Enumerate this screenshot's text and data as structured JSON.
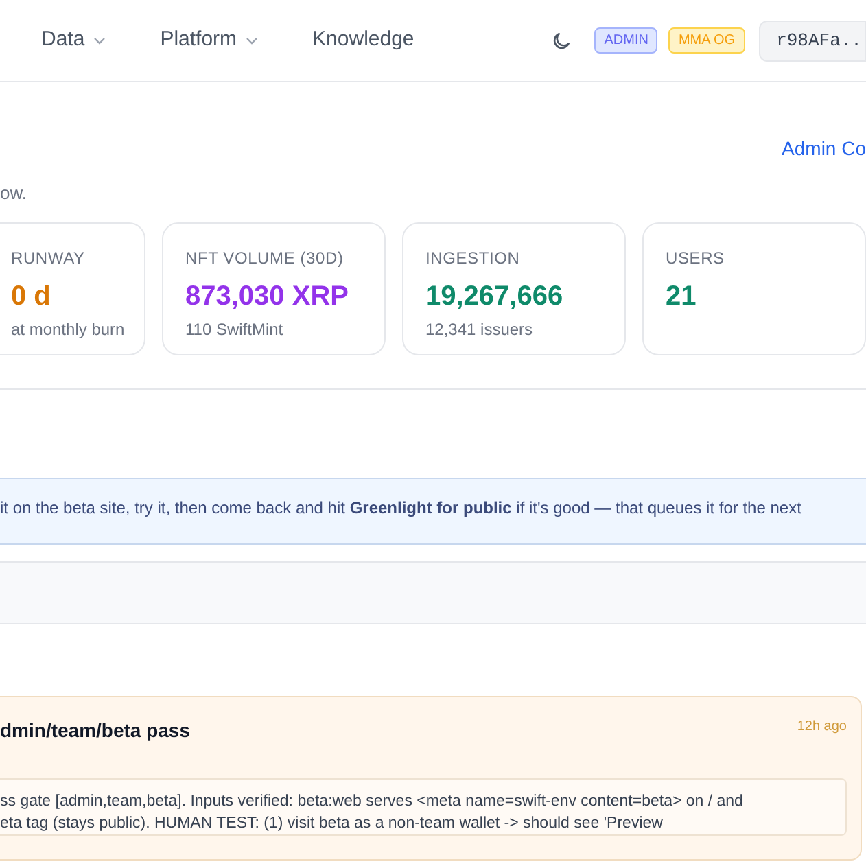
{
  "nav": {
    "items": [
      {
        "label": "Data",
        "dropdown": true
      },
      {
        "label": "Platform",
        "dropdown": true
      },
      {
        "label": "Knowledge",
        "dropdown": false
      }
    ],
    "badges": [
      {
        "label": "ADMIN",
        "kind": "admin"
      },
      {
        "label": "MMA OG",
        "kind": "og"
      }
    ],
    "wallet": "r98AFa.."
  },
  "header": {
    "link": "Admin Co",
    "subtitle": "ow."
  },
  "stats": [
    {
      "label": "RUNWAY",
      "value": "0 d",
      "sub": "at monthly burn",
      "color": "#d97706"
    },
    {
      "label": "NFT VOLUME (30D)",
      "value": "873,030 XRP",
      "sub": "110 SwiftMint",
      "color": "#9333ea"
    },
    {
      "label": "INGESTION",
      "value": "19,267,666",
      "sub": "12,341 issuers",
      "color": "#0f8a6a"
    },
    {
      "label": "USERS",
      "value": "21",
      "color": "#0f8a6a"
    }
  ],
  "notice": "it on the beta site, try it, then come back and hit **Greenlight for public** if it's good — that queues it for the next",
  "item": {
    "title": "dmin/team/beta pass",
    "time": "12h ago",
    "body": [
      "ss gate [admin,team,beta]. Inputs verified: beta:web serves <meta name=swift-env content=beta> on / and",
      "eta tag (stays public). HUMAN TEST: (1) visit beta as a non-team wallet -> should see 'Preview"
    ]
  }
}
